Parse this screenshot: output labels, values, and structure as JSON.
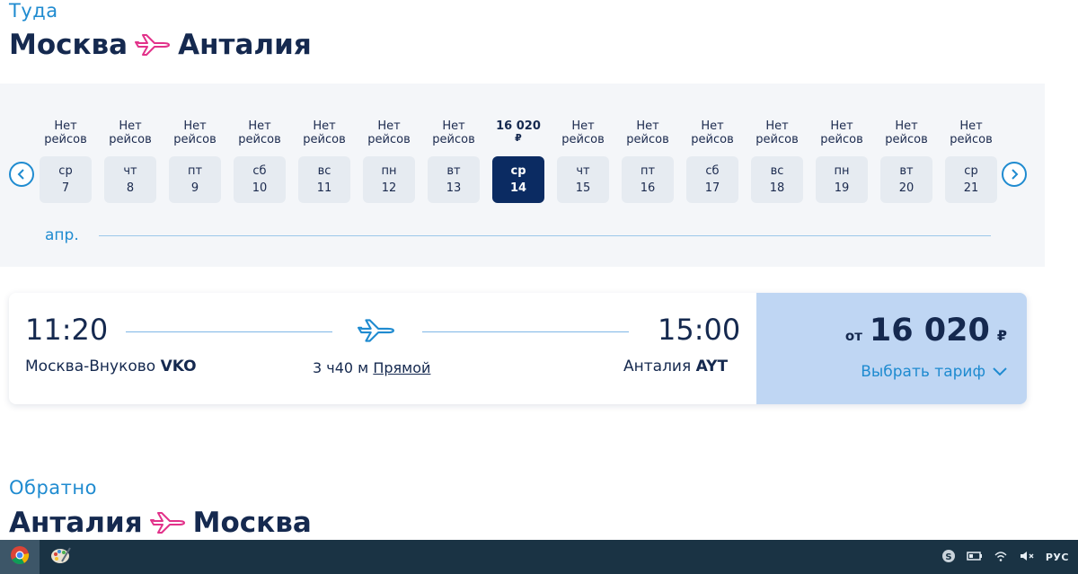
{
  "outbound": {
    "direction_label": "Туда",
    "from_city": "Москва",
    "to_city": "Анталия"
  },
  "calendar": {
    "month_label": "апр.",
    "days": [
      {
        "weekday": "ср",
        "date": "7",
        "price_line1": "Нет",
        "price_line2": "рейсов",
        "has_price": false,
        "selected": false
      },
      {
        "weekday": "чт",
        "date": "8",
        "price_line1": "Нет",
        "price_line2": "рейсов",
        "has_price": false,
        "selected": false
      },
      {
        "weekday": "пт",
        "date": "9",
        "price_line1": "Нет",
        "price_line2": "рейсов",
        "has_price": false,
        "selected": false
      },
      {
        "weekday": "сб",
        "date": "10",
        "price_line1": "Нет",
        "price_line2": "рейсов",
        "has_price": false,
        "selected": false
      },
      {
        "weekday": "вс",
        "date": "11",
        "price_line1": "Нет",
        "price_line2": "рейсов",
        "has_price": false,
        "selected": false
      },
      {
        "weekday": "пн",
        "date": "12",
        "price_line1": "Нет",
        "price_line2": "рейсов",
        "has_price": false,
        "selected": false
      },
      {
        "weekday": "вт",
        "date": "13",
        "price_line1": "Нет",
        "price_line2": "рейсов",
        "has_price": false,
        "selected": false
      },
      {
        "weekday": "ср",
        "date": "14",
        "price_line1": "16 020",
        "price_line2": "₽",
        "has_price": true,
        "selected": true
      },
      {
        "weekday": "чт",
        "date": "15",
        "price_line1": "Нет",
        "price_line2": "рейсов",
        "has_price": false,
        "selected": false
      },
      {
        "weekday": "пт",
        "date": "16",
        "price_line1": "Нет",
        "price_line2": "рейсов",
        "has_price": false,
        "selected": false
      },
      {
        "weekday": "сб",
        "date": "17",
        "price_line1": "Нет",
        "price_line2": "рейсов",
        "has_price": false,
        "selected": false
      },
      {
        "weekday": "вс",
        "date": "18",
        "price_line1": "Нет",
        "price_line2": "рейсов",
        "has_price": false,
        "selected": false
      },
      {
        "weekday": "пн",
        "date": "19",
        "price_line1": "Нет",
        "price_line2": "рейсов",
        "has_price": false,
        "selected": false
      },
      {
        "weekday": "вт",
        "date": "20",
        "price_line1": "Нет",
        "price_line2": "рейсов",
        "has_price": false,
        "selected": false
      },
      {
        "weekday": "ср",
        "date": "21",
        "price_line1": "Нет",
        "price_line2": "рейсов",
        "has_price": false,
        "selected": false
      }
    ]
  },
  "flight": {
    "departure_time": "11:20",
    "arrival_time": "15:00",
    "departure_airport": "Москва-Внуково",
    "departure_code": "VKO",
    "arrival_airport": "Анталия",
    "arrival_code": "AYT",
    "duration": "3 ч40 м",
    "stops": "Прямой",
    "price_prefix": "от",
    "price": "16 020",
    "currency": "₽",
    "tariff_button": "Выбрать тариф"
  },
  "return": {
    "direction_label": "Обратно",
    "from_city": "Анталия",
    "to_city": "Москва"
  },
  "taskbar": {
    "tray_lang": "РУС",
    "icons": [
      "chrome-icon",
      "paint-icon",
      "skype-icon",
      "battery-icon",
      "wifi-icon",
      "volume-muted-icon"
    ]
  },
  "colors": {
    "brand_navy": "#15294f",
    "accent_blue": "#1f8bd0",
    "accent_pink": "#e2328a",
    "selected_day": "#0b2b62",
    "price_panel": "#bfd6f3"
  }
}
